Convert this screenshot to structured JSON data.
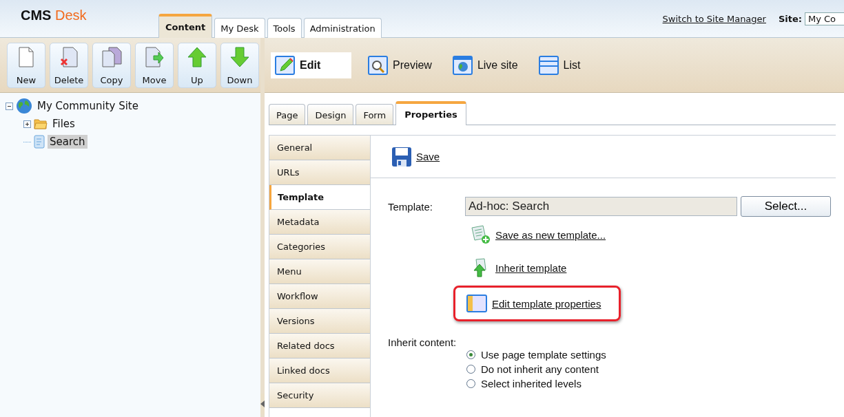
{
  "header": {
    "logo": {
      "part_1": "CMS",
      "part_2": "Desk"
    },
    "tabs": [
      {
        "label": "Content",
        "selected": true
      },
      {
        "label": "My Desk",
        "selected": false
      },
      {
        "label": "Tools",
        "selected": false
      },
      {
        "label": "Administration",
        "selected": false
      }
    ],
    "switch_link": "Switch to Site Manager",
    "site_label": "Site:",
    "site_value": "My Co"
  },
  "actions": [
    {
      "label": "New",
      "kind": "new"
    },
    {
      "label": "Delete",
      "kind": "delete"
    },
    {
      "label": "Copy",
      "kind": "copy"
    },
    {
      "label": "Move",
      "kind": "move"
    },
    {
      "label": "Up",
      "kind": "up"
    },
    {
      "label": "Down",
      "kind": "down"
    }
  ],
  "views": [
    {
      "label": "Edit",
      "kind": "edit",
      "selected": true
    },
    {
      "label": "Preview",
      "kind": "preview",
      "selected": false
    },
    {
      "label": "Live site",
      "kind": "live",
      "selected": false
    },
    {
      "label": "List",
      "kind": "list",
      "selected": false
    }
  ],
  "tree": {
    "label": "My Community Site",
    "kind": "site",
    "expanded": true,
    "selected": false,
    "children": [
      {
        "label": "Files",
        "kind": "folder",
        "expanded": false,
        "selected": false
      },
      {
        "label": "Search",
        "kind": "page",
        "selected": true
      }
    ]
  },
  "page_tabs": [
    {
      "label": "Page",
      "selected": false
    },
    {
      "label": "Design",
      "selected": false
    },
    {
      "label": "Form",
      "selected": false
    },
    {
      "label": "Properties",
      "selected": true
    }
  ],
  "side_tabs": [
    {
      "label": "General",
      "selected": false
    },
    {
      "label": "URLs",
      "selected": false
    },
    {
      "label": "Template",
      "selected": true
    },
    {
      "label": "Metadata",
      "selected": false
    },
    {
      "label": "Categories",
      "selected": false
    },
    {
      "label": "Menu",
      "selected": false
    },
    {
      "label": "Workflow",
      "selected": false
    },
    {
      "label": "Versions",
      "selected": false
    },
    {
      "label": "Related docs",
      "selected": false
    },
    {
      "label": "Linked docs",
      "selected": false
    },
    {
      "label": "Security",
      "selected": false
    }
  ],
  "save": "Save",
  "template": {
    "label": "Template:",
    "value": "Ad-hoc: Search",
    "button": "Select..."
  },
  "template_actions": [
    {
      "label": "Save as new template...",
      "kind": "save_new",
      "highlighted": false
    },
    {
      "label": "Inherit template",
      "kind": "inherit",
      "highlighted": false
    },
    {
      "label": "Edit template properties",
      "kind": "edit",
      "highlighted": true
    }
  ],
  "inherit": {
    "label": "Inherit content:",
    "options": [
      {
        "label": "Use page template settings",
        "selected": true
      },
      {
        "label": "Do not inherit any content",
        "selected": false
      },
      {
        "label": "Select inherited levels",
        "selected": false
      }
    ]
  }
}
